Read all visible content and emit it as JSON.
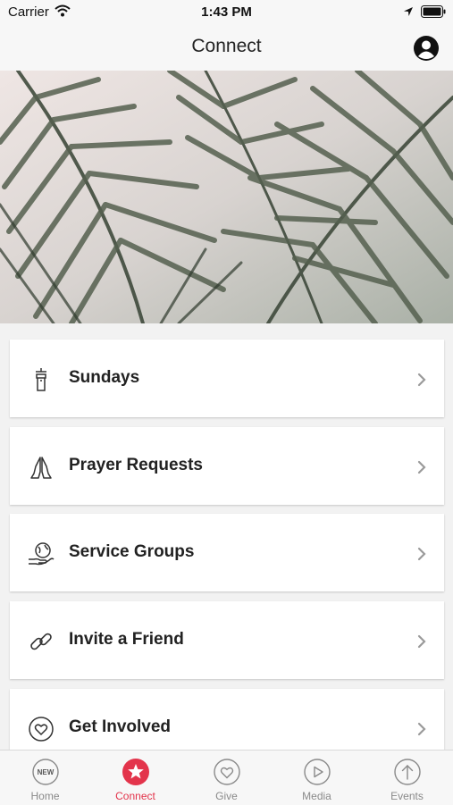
{
  "status_bar": {
    "carrier": "Carrier",
    "time": "1:43 PM"
  },
  "nav": {
    "title": "Connect",
    "profile_icon": "user-circle-icon"
  },
  "hero": {
    "image": "palm-leaves-photo"
  },
  "menu": [
    {
      "label": "Sundays",
      "icon": "church-podium-icon"
    },
    {
      "label": "Prayer Requests",
      "icon": "praying-hands-icon"
    },
    {
      "label": "Service Groups",
      "icon": "globe-in-hand-icon"
    },
    {
      "label": "Invite a Friend",
      "icon": "link-icon"
    },
    {
      "label": "Get Involved",
      "icon": "heart-circle-icon"
    }
  ],
  "tabs": [
    {
      "label": "Home",
      "icon": "new-badge-icon",
      "active": false
    },
    {
      "label": "Connect",
      "icon": "star-icon",
      "active": true
    },
    {
      "label": "Give",
      "icon": "heart-icon",
      "active": false
    },
    {
      "label": "Media",
      "icon": "play-icon",
      "active": false
    },
    {
      "label": "Events",
      "icon": "arrow-up-icon",
      "active": false
    }
  ],
  "colors": {
    "accent": "#e3344b",
    "inactive": "#8a8a8a",
    "bar_background": "#f7f7f7",
    "page_background": "#f2f2f2"
  }
}
